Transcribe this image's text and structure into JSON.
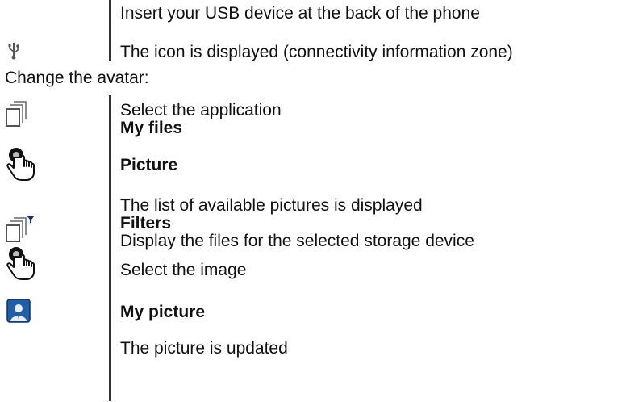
{
  "section1": {
    "step1": "Insert your USB device at the back of the phone",
    "step2": "The icon is displayed (connectivity information zone)"
  },
  "heading": "Change the avatar:",
  "section2": {
    "select_app": "Select the application",
    "my_files": "My files",
    "picture": "Picture",
    "list_displayed": "The list of available pictures is displayed",
    "filters": "Filters",
    "display_files": "Display the files for the selected storage device",
    "select_image": "Select the image",
    "my_picture": "My picture",
    "picture_updated": "The picture is updated"
  },
  "icons": [
    "usb-icon",
    "files-icon",
    "tap-hand-icon",
    "files-filter-icon",
    "tap-hand-icon",
    "avatar-picture-icon"
  ],
  "colors": {
    "text": "#111111",
    "divider": "#333333",
    "avatar_bg": "#1f5fa8"
  }
}
